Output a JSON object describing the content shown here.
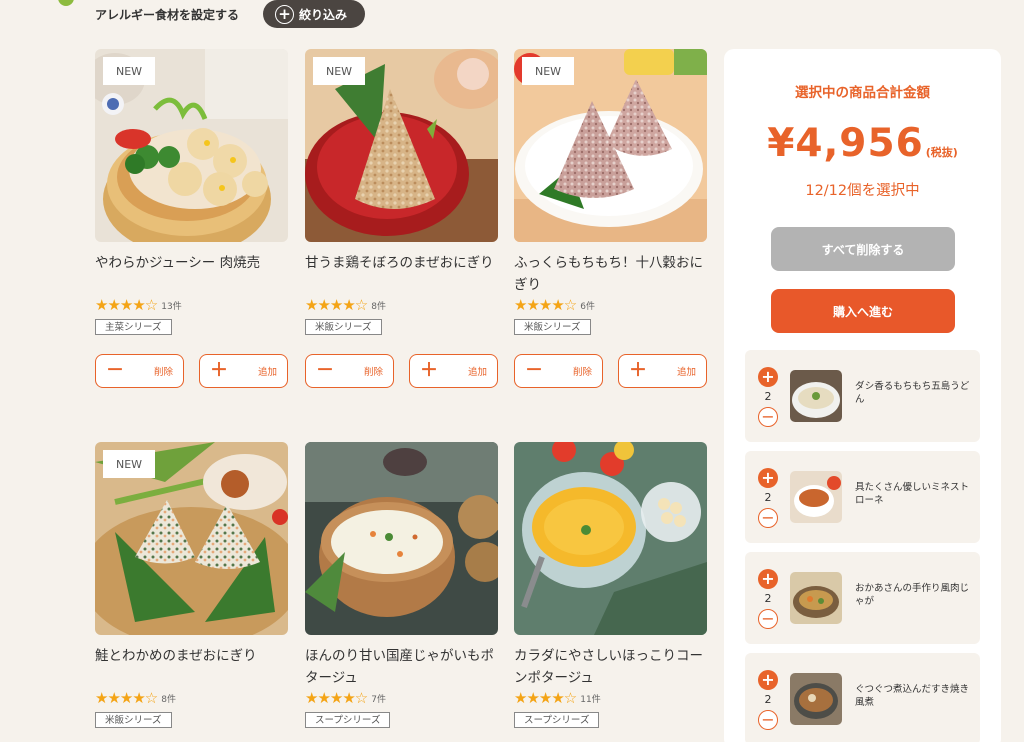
{
  "header": {
    "allergy_link": "アレルギー食材を設定する",
    "filter_label": "絞り込み"
  },
  "products": [
    {
      "badge": "NEW",
      "name": "やわらかジューシー 肉焼売",
      "stars": "★★★★☆",
      "count": "13件",
      "rating": 4.5,
      "series": "主菜シリーズ",
      "remove": "削除",
      "add": "追加"
    },
    {
      "badge": "NEW",
      "name": "甘うま鶏そぼろのまぜおにぎり",
      "stars": "★★★★☆",
      "count": "8件",
      "rating": 4.5,
      "series": "米飯シリーズ",
      "remove": "削除",
      "add": "追加"
    },
    {
      "badge": "NEW",
      "name": "ふっくらもちもち！十八穀おにぎり",
      "stars": "★★★★☆",
      "count": "6件",
      "rating": 4.5,
      "series": "米飯シリーズ",
      "remove": "削除",
      "add": "追加"
    },
    {
      "badge": "NEW",
      "name": "鮭とわかめのまぜおにぎり",
      "stars": "★★★★☆",
      "count": "8件",
      "rating": 4.5,
      "series": "米飯シリーズ"
    },
    {
      "name": "ほんのり甘い国産じゃがいもポタージュ",
      "stars": "★★★★☆",
      "count": "7件",
      "rating": 4.5,
      "series": "スープシリーズ"
    },
    {
      "name": "カラダにやさしいほっこりコーンポタージュ",
      "stars": "★★★★☆",
      "count": "11件",
      "rating": 4.5,
      "series": "スープシリーズ"
    }
  ],
  "summary": {
    "title": "選択中の商品合計金額",
    "amount": "¥4,956",
    "tax_note": "(税抜)",
    "selected": "12/12個を選択中",
    "clear_label": "すべて削除する",
    "buy_label": "購入へ進む"
  },
  "cart": [
    {
      "qty": "2",
      "name": "ダシ香るもちもち五島うどん"
    },
    {
      "qty": "2",
      "name": "具たくさん優しいミネストローネ"
    },
    {
      "qty": "2",
      "name": "おかあさんの手作り風肉じゃが"
    },
    {
      "qty": "2",
      "name": "ぐつぐつ煮込んだすき焼き風煮"
    }
  ],
  "colors": {
    "accent": "#e8632a",
    "star": "#f4a416",
    "background": "#f6f2ec"
  }
}
